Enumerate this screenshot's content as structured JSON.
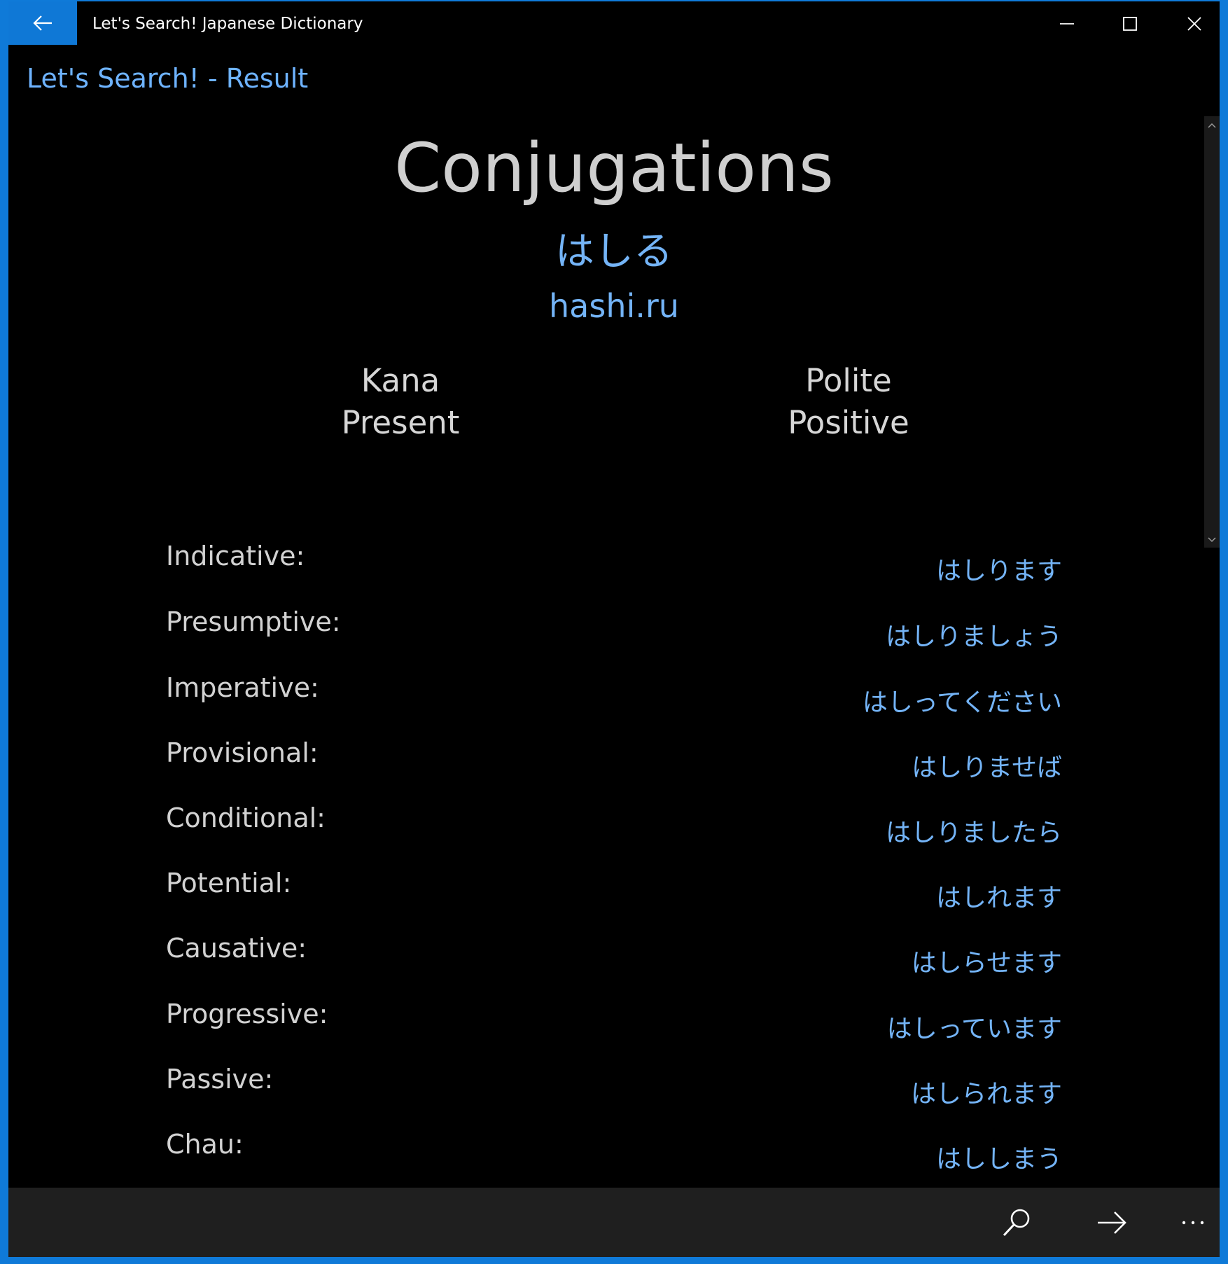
{
  "window": {
    "title": "Let's Search! Japanese Dictionary",
    "accent_color": "#0f78d6"
  },
  "header": {
    "title": "Let's Search! - Result"
  },
  "main": {
    "heading": "Conjugations",
    "kana": "はしる",
    "romaji": "hashi.ru",
    "columns": {
      "left": [
        "Kana",
        "Present"
      ],
      "right": [
        "Polite",
        "Positive"
      ]
    },
    "rows": [
      {
        "label": "Indicative:",
        "value": "はしります"
      },
      {
        "label": "Presumptive:",
        "value": "はしりましょう"
      },
      {
        "label": "Imperative:",
        "value": "はしってください"
      },
      {
        "label": "Provisional:",
        "value": "はしりませば"
      },
      {
        "label": "Conditional:",
        "value": "はしりましたら"
      },
      {
        "label": "Potential:",
        "value": "はしれます"
      },
      {
        "label": "Causative:",
        "value": "はしらせます"
      },
      {
        "label": "Progressive:",
        "value": "はしっています"
      },
      {
        "label": "Passive:",
        "value": "はしられます"
      },
      {
        "label": "Chau:",
        "value": "はししまう"
      }
    ]
  },
  "icons": {
    "back": "back-arrow-icon",
    "minimize": "minimize-icon",
    "maximize": "maximize-icon",
    "close": "close-icon",
    "search": "search-icon",
    "forward": "forward-arrow-icon",
    "more": "more-icon"
  }
}
